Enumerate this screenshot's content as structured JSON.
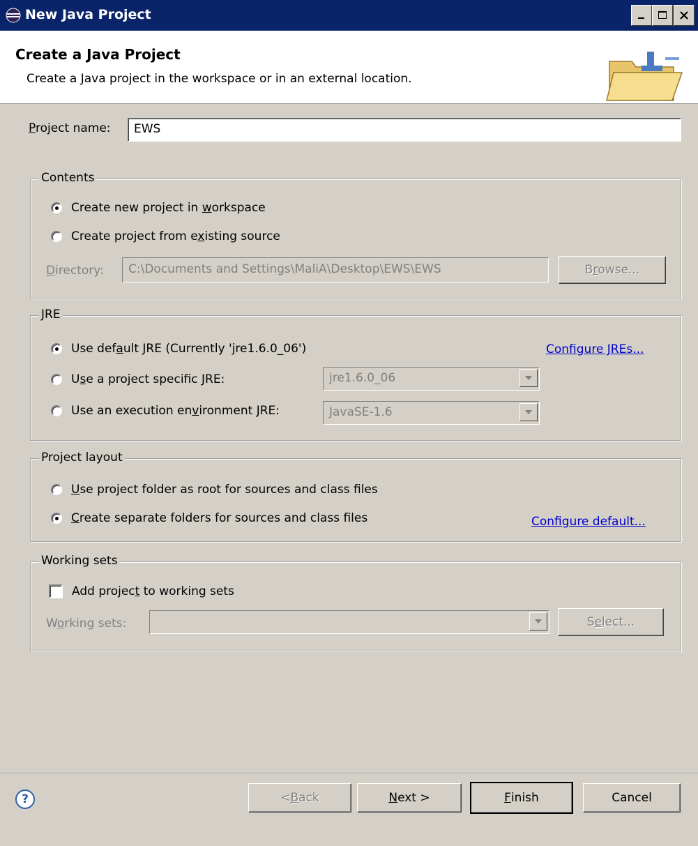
{
  "window": {
    "title": "New Java Project",
    "controls": [
      "minimize",
      "maximize",
      "close"
    ]
  },
  "header": {
    "title": "Create a Java Project",
    "description": "Create a Java project in the workspace or in an external location."
  },
  "project_name": {
    "label_mnemonic": "P",
    "label_rest": "roject name:",
    "value": "EWS"
  },
  "contents": {
    "legend": "Contents",
    "opt_new_pre": "Create new project in ",
    "opt_new_mn": "w",
    "opt_new_post": "orkspace",
    "opt_new_selected": true,
    "opt_existing_pre": "Create project from e",
    "opt_existing_mn": "x",
    "opt_existing_post": "isting source",
    "opt_existing_selected": false,
    "directory_mn": "D",
    "directory_rest": "irectory:",
    "directory_value": "C:\\Documents and Settings\\MaliA\\Desktop\\EWS\\EWS",
    "browse_pre": "B",
    "browse_mn": "r",
    "browse_post": "owse..."
  },
  "jre": {
    "legend": "JRE",
    "opt_default_pre": "Use def",
    "opt_default_mn": "a",
    "opt_default_post": "ult JRE (Currently 'jre1.6.0_06')",
    "opt_default_selected": true,
    "opt_specific_pre": "U",
    "opt_specific_mn": "s",
    "opt_specific_post": "e a project specific JRE:",
    "opt_specific_selected": false,
    "opt_env_pre": "Use an execution en",
    "opt_env_mn": "v",
    "opt_env_post": "ironment JRE:",
    "opt_env_selected": false,
    "configure_link": "Configure JREs...",
    "specific_value": "jre1.6.0_06",
    "env_value": "JavaSE-1.6"
  },
  "layout": {
    "legend": "Project layout",
    "opt_root_mn": "U",
    "opt_root_rest": "se project folder as root for sources and class files",
    "opt_root_selected": false,
    "opt_sep_mn": "C",
    "opt_sep_rest": "reate separate folders for sources and class files",
    "opt_sep_selected": true,
    "configure_link": "Configure default..."
  },
  "working_sets": {
    "legend": "Working sets",
    "add_pre": "Add projec",
    "add_mn": "t",
    "add_post": " to working sets",
    "add_checked": false,
    "ws_pre": "W",
    "ws_mn": "o",
    "ws_post": "rking sets:",
    "ws_value": "",
    "select_pre": "S",
    "select_mn": "e",
    "select_post": "lect..."
  },
  "footer": {
    "help_symbol": "?",
    "back_pre": "< ",
    "back_mn": "B",
    "back_post": "ack",
    "next_mn": "N",
    "next_post": "ext >",
    "finish_mn": "F",
    "finish_post": "inish",
    "cancel": "Cancel"
  },
  "colors": {
    "titlebar": "#0a246a",
    "dialog_bg": "#d4d0c8",
    "link": "#0000cc",
    "disabled_text": "#808080"
  }
}
